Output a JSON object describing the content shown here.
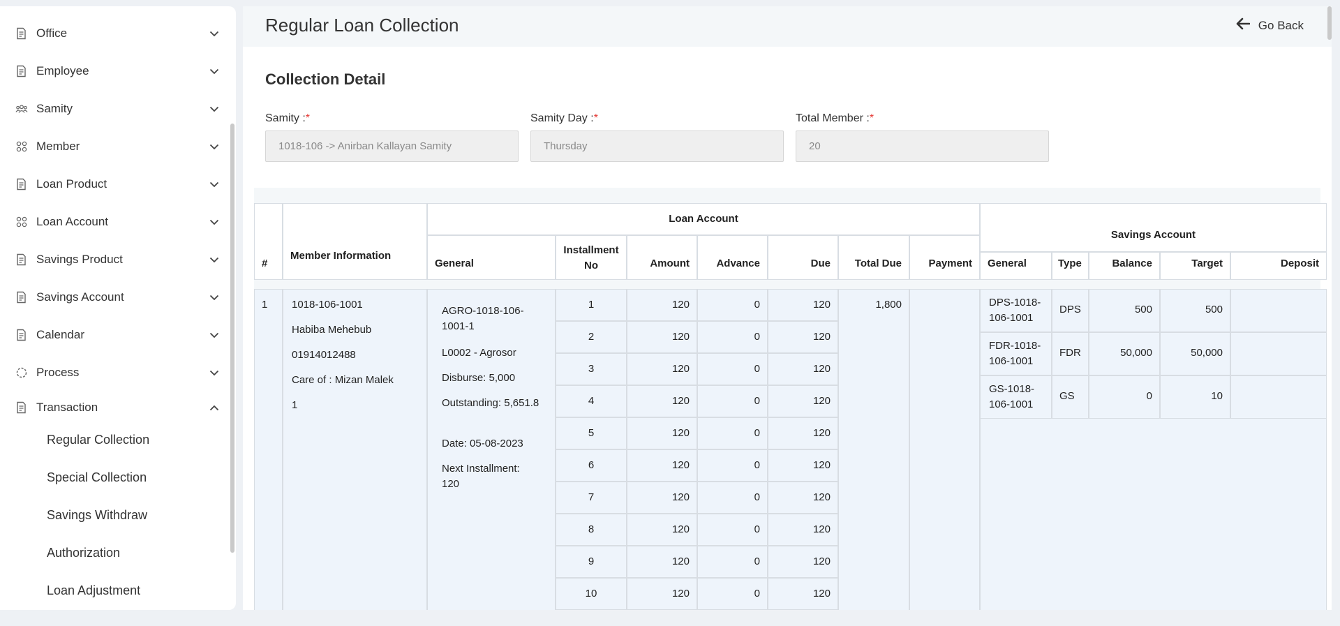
{
  "sidebar": {
    "items": [
      {
        "label": "Office",
        "icon": "document-icon"
      },
      {
        "label": "Employee",
        "icon": "document-icon"
      },
      {
        "label": "Samity",
        "icon": "group-icon"
      },
      {
        "label": "Member",
        "icon": "members-icon"
      },
      {
        "label": "Loan Product",
        "icon": "document-icon"
      },
      {
        "label": "Loan Account",
        "icon": "members-icon"
      },
      {
        "label": "Savings Product",
        "icon": "document-icon"
      },
      {
        "label": "Savings Account",
        "icon": "document-icon"
      },
      {
        "label": "Calendar",
        "icon": "document-icon"
      },
      {
        "label": "Process",
        "icon": "process-icon"
      },
      {
        "label": "Transaction",
        "icon": "document-icon"
      }
    ],
    "submenu": [
      "Regular Collection",
      "Special Collection",
      "Savings Withdraw",
      "Authorization",
      "Loan Adjustment"
    ]
  },
  "header": {
    "title": "Regular Loan Collection",
    "go_back": "Go Back"
  },
  "section_title": "Collection Detail",
  "fields": {
    "samity": {
      "label": "Samity :",
      "value": "1018-106 -> Anirban Kallayan Samity"
    },
    "samity_day": {
      "label": "Samity Day :",
      "value": "Thursday"
    },
    "total_member": {
      "label": "Total Member :",
      "value": "20"
    },
    "required_mark": "*"
  },
  "table": {
    "headers": {
      "num": "#",
      "member_info": "Member Information",
      "loan_account": "Loan Account",
      "savings_account": "Savings Account",
      "general": "General",
      "installment_no": "Installment No",
      "amount": "Amount",
      "advance": "Advance",
      "due": "Due",
      "total_due": "Total Due",
      "payment": "Payment",
      "s_general": "General",
      "type": "Type",
      "balance": "Balance",
      "target": "Target",
      "deposit": "Deposit"
    },
    "row": {
      "num": "1",
      "member": [
        "1018-106-1001",
        "Habiba Mehebub",
        "01914012488",
        "Care of : Mizan Malek",
        "1"
      ],
      "loan_general": [
        "AGRO-1018-106-1001-1",
        "L0002 - Agrosor",
        "Disburse: 5,000",
        "Outstanding: 5,651.8",
        "Date: 05-08-2023",
        "Next Installment: 120"
      ],
      "installments": [
        {
          "no": "1",
          "amount": "120",
          "advance": "0",
          "due": "120"
        },
        {
          "no": "2",
          "amount": "120",
          "advance": "0",
          "due": "120"
        },
        {
          "no": "3",
          "amount": "120",
          "advance": "0",
          "due": "120"
        },
        {
          "no": "4",
          "amount": "120",
          "advance": "0",
          "due": "120"
        },
        {
          "no": "5",
          "amount": "120",
          "advance": "0",
          "due": "120"
        },
        {
          "no": "6",
          "amount": "120",
          "advance": "0",
          "due": "120"
        },
        {
          "no": "7",
          "amount": "120",
          "advance": "0",
          "due": "120"
        },
        {
          "no": "8",
          "amount": "120",
          "advance": "0",
          "due": "120"
        },
        {
          "no": "9",
          "amount": "120",
          "advance": "0",
          "due": "120"
        },
        {
          "no": "10",
          "amount": "120",
          "advance": "0",
          "due": "120"
        }
      ],
      "total_due": "1,800",
      "savings": [
        {
          "general": "DPS-1018-106-1001",
          "type": "DPS",
          "balance": "500",
          "target": "500"
        },
        {
          "general": "FDR-1018-106-1001",
          "type": "FDR",
          "balance": "50,000",
          "target": "50,000"
        },
        {
          "general": "GS-1018-106-1001",
          "type": "GS",
          "balance": "0",
          "target": "10"
        }
      ]
    }
  }
}
